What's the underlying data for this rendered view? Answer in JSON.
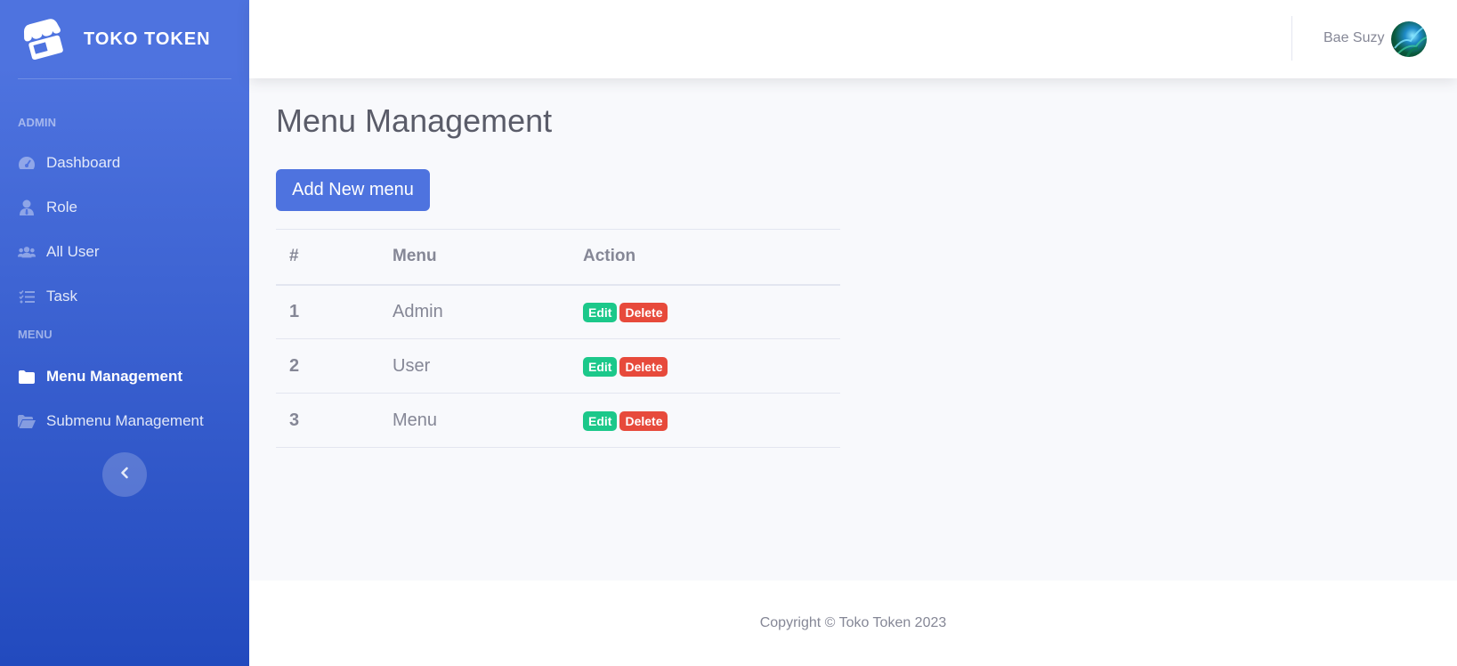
{
  "brand": {
    "name": "TOKO TOKEN",
    "icon": "store-icon"
  },
  "sidebar": {
    "headings": [
      "ADMIN",
      "MENU"
    ],
    "items": [
      {
        "label": "Dashboard",
        "icon": "tachometer-icon"
      },
      {
        "label": "Role",
        "icon": "user-tie-icon"
      },
      {
        "label": "All User",
        "icon": "users-icon"
      },
      {
        "label": "Task",
        "icon": "tasks-icon"
      },
      {
        "label": "Menu Management",
        "icon": "folder-icon",
        "active": true
      },
      {
        "label": "Submenu Management",
        "icon": "folder-open-icon"
      }
    ],
    "toggle_icon": "chevron-left-icon"
  },
  "topbar": {
    "user_name": "Bae Suzy"
  },
  "main": {
    "title": "Menu Management",
    "add_button": "Add New menu",
    "table": {
      "headers": [
        "#",
        "Menu",
        "Action"
      ],
      "rows": [
        {
          "num": "1",
          "menu": "Admin",
          "edit": "Edit",
          "delete": "Delete"
        },
        {
          "num": "2",
          "menu": "User",
          "edit": "Edit",
          "delete": "Delete"
        },
        {
          "num": "3",
          "menu": "Menu",
          "edit": "Edit",
          "delete": "Delete"
        }
      ]
    }
  },
  "footer": {
    "copyright": "Copyright © Toko Token 2023"
  },
  "colors": {
    "primary": "#4e73df",
    "success": "#1cc88a",
    "danger": "#e74a3b",
    "text_muted": "#858796"
  }
}
